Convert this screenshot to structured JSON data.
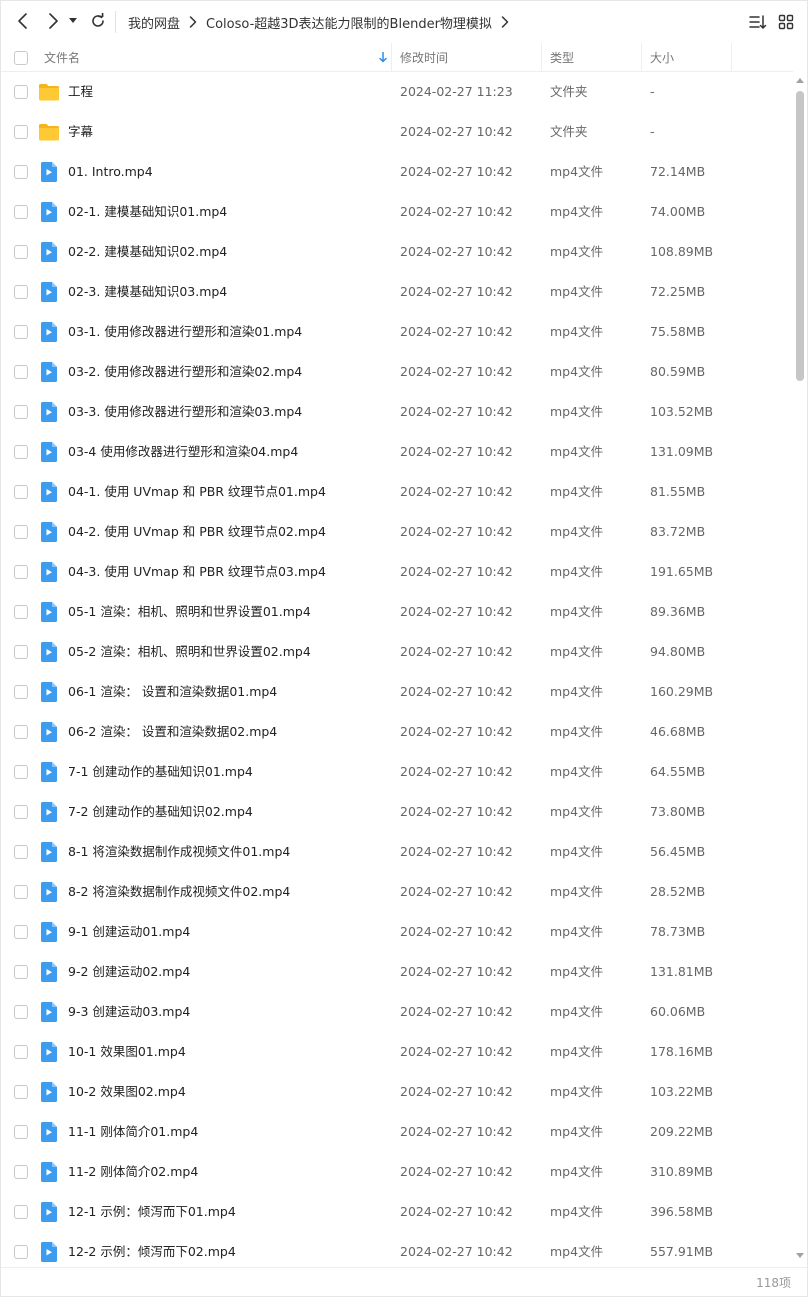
{
  "toolbar": {
    "back_icon": "arrow-left-icon",
    "forward_icon": "arrow-right-icon",
    "history_icon": "caret-down-icon",
    "refresh_icon": "refresh-icon",
    "sort_icon": "sort-icon",
    "grid_icon": "grid-view-icon"
  },
  "breadcrumb": {
    "root": "我的网盘",
    "current": "Coloso-超越3D表达能力限制的Blender物理模拟"
  },
  "header": {
    "name": "文件名",
    "time": "修改时间",
    "type": "类型",
    "size": "大小"
  },
  "files": [
    {
      "name": "工程",
      "time": "2024-02-27 11:23",
      "type": "文件夹",
      "size": "-",
      "kind": "folder"
    },
    {
      "name": "字幕",
      "time": "2024-02-27 10:42",
      "type": "文件夹",
      "size": "-",
      "kind": "folder"
    },
    {
      "name": "01. Intro.mp4",
      "time": "2024-02-27 10:42",
      "type": "mp4文件",
      "size": "72.14MB",
      "kind": "video"
    },
    {
      "name": "02-1. 建模基础知识01.mp4",
      "time": "2024-02-27 10:42",
      "type": "mp4文件",
      "size": "74.00MB",
      "kind": "video"
    },
    {
      "name": "02-2. 建模基础知识02.mp4",
      "time": "2024-02-27 10:42",
      "type": "mp4文件",
      "size": "108.89MB",
      "kind": "video"
    },
    {
      "name": "02-3. 建模基础知识03.mp4",
      "time": "2024-02-27 10:42",
      "type": "mp4文件",
      "size": "72.25MB",
      "kind": "video"
    },
    {
      "name": "03-1. 使用修改器进行塑形和渲染01.mp4",
      "time": "2024-02-27 10:42",
      "type": "mp4文件",
      "size": "75.58MB",
      "kind": "video"
    },
    {
      "name": "03-2. 使用修改器进行塑形和渲染02.mp4",
      "time": "2024-02-27 10:42",
      "type": "mp4文件",
      "size": "80.59MB",
      "kind": "video"
    },
    {
      "name": "03-3. 使用修改器进行塑形和渲染03.mp4",
      "time": "2024-02-27 10:42",
      "type": "mp4文件",
      "size": "103.52MB",
      "kind": "video"
    },
    {
      "name": "03-4 使用修改器进行塑形和渲染04.mp4",
      "time": "2024-02-27 10:42",
      "type": "mp4文件",
      "size": "131.09MB",
      "kind": "video"
    },
    {
      "name": "04-1. 使用 UVmap 和 PBR 纹理节点01.mp4",
      "time": "2024-02-27 10:42",
      "type": "mp4文件",
      "size": "81.55MB",
      "kind": "video"
    },
    {
      "name": "04-2. 使用 UVmap 和 PBR 纹理节点02.mp4",
      "time": "2024-02-27 10:42",
      "type": "mp4文件",
      "size": "83.72MB",
      "kind": "video"
    },
    {
      "name": "04-3. 使用 UVmap 和 PBR 纹理节点03.mp4",
      "time": "2024-02-27 10:42",
      "type": "mp4文件",
      "size": "191.65MB",
      "kind": "video"
    },
    {
      "name": "05-1 渲染：相机、照明和世界设置01.mp4",
      "time": "2024-02-27 10:42",
      "type": "mp4文件",
      "size": "89.36MB",
      "kind": "video"
    },
    {
      "name": "05-2 渲染：相机、照明和世界设置02.mp4",
      "time": "2024-02-27 10:42",
      "type": "mp4文件",
      "size": "94.80MB",
      "kind": "video"
    },
    {
      "name": "06-1 渲染： 设置和渲染数据01.mp4",
      "time": "2024-02-27 10:42",
      "type": "mp4文件",
      "size": "160.29MB",
      "kind": "video"
    },
    {
      "name": "06-2 渲染： 设置和渲染数据02.mp4",
      "time": "2024-02-27 10:42",
      "type": "mp4文件",
      "size": "46.68MB",
      "kind": "video"
    },
    {
      "name": "7-1 创建动作的基础知识01.mp4",
      "time": "2024-02-27 10:42",
      "type": "mp4文件",
      "size": "64.55MB",
      "kind": "video"
    },
    {
      "name": "7-2 创建动作的基础知识02.mp4",
      "time": "2024-02-27 10:42",
      "type": "mp4文件",
      "size": "73.80MB",
      "kind": "video"
    },
    {
      "name": "8-1 将渲染数据制作成视频文件01.mp4",
      "time": "2024-02-27 10:42",
      "type": "mp4文件",
      "size": "56.45MB",
      "kind": "video"
    },
    {
      "name": "8-2 将渲染数据制作成视频文件02.mp4",
      "time": "2024-02-27 10:42",
      "type": "mp4文件",
      "size": "28.52MB",
      "kind": "video"
    },
    {
      "name": "9-1 创建运动01.mp4",
      "time": "2024-02-27 10:42",
      "type": "mp4文件",
      "size": "78.73MB",
      "kind": "video"
    },
    {
      "name": "9-2 创建运动02.mp4",
      "time": "2024-02-27 10:42",
      "type": "mp4文件",
      "size": "131.81MB",
      "kind": "video"
    },
    {
      "name": "9-3 创建运动03.mp4",
      "time": "2024-02-27 10:42",
      "type": "mp4文件",
      "size": "60.06MB",
      "kind": "video"
    },
    {
      "name": "10-1 效果图01.mp4",
      "time": "2024-02-27 10:42",
      "type": "mp4文件",
      "size": "178.16MB",
      "kind": "video"
    },
    {
      "name": "10-2 效果图02.mp4",
      "time": "2024-02-27 10:42",
      "type": "mp4文件",
      "size": "103.22MB",
      "kind": "video"
    },
    {
      "name": "11-1 刚体简介01.mp4",
      "time": "2024-02-27 10:42",
      "type": "mp4文件",
      "size": "209.22MB",
      "kind": "video"
    },
    {
      "name": "11-2 刚体简介02.mp4",
      "time": "2024-02-27 10:42",
      "type": "mp4文件",
      "size": "310.89MB",
      "kind": "video"
    },
    {
      "name": "12-1 示例：倾泻而下01.mp4",
      "time": "2024-02-27 10:42",
      "type": "mp4文件",
      "size": "396.58MB",
      "kind": "video"
    },
    {
      "name": "12-2 示例：倾泻而下02.mp4",
      "time": "2024-02-27 10:42",
      "type": "mp4文件",
      "size": "557.91MB",
      "kind": "video"
    }
  ],
  "footer": {
    "count": "118项"
  },
  "colors": {
    "folder": "#FFC933",
    "folder_back": "#F5B420",
    "video": "#3D9BF0",
    "sort_arrow": "#2A8DE8"
  }
}
